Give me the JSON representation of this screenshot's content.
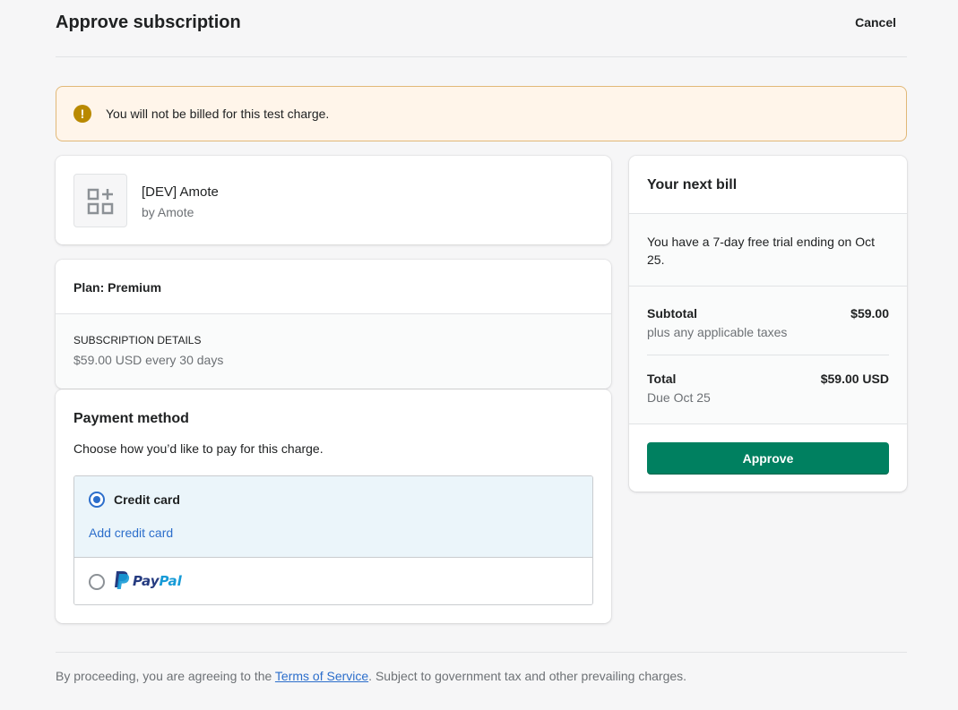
{
  "header": {
    "title": "Approve subscription",
    "cancel_label": "Cancel"
  },
  "banner": {
    "icon": "alert-circle-icon",
    "icon_glyph": "!",
    "text": "You will not be billed for this test charge."
  },
  "app": {
    "icon": "apps-icon",
    "name": "[DEV] Amote",
    "by": "by Amote"
  },
  "plan": {
    "label": "Plan: Premium",
    "details_heading": "SUBSCRIPTION DETAILS",
    "details_price": "$59.00 USD every 30 days"
  },
  "payment": {
    "title": "Payment method",
    "description": "Choose how you’d like to pay for this charge.",
    "options": [
      {
        "label": "Credit card",
        "selected": true,
        "action_label": "Add credit card"
      },
      {
        "label": "PayPal",
        "logo_text_1": "Pay",
        "logo_text_2": "Pal",
        "selected": false
      }
    ]
  },
  "bill": {
    "title": "Your next bill",
    "trial_text": "You have a 7-day free trial ending on Oct 25.",
    "subtotal_label": "Subtotal",
    "subtotal_value": "$59.00",
    "subtotal_note": "plus any applicable taxes",
    "total_label": "Total",
    "total_value": "$59.00 USD",
    "total_note": "Due Oct 25",
    "approve_label": "Approve"
  },
  "footer": {
    "text_before": "By proceeding, you are agreeing to the ",
    "terms_link": "Terms of Service",
    "text_after": ". Subject to government tax and other prevailing charges."
  },
  "colors": {
    "primary": "#008060",
    "link": "#2c6ecb",
    "banner_bg": "#fff5ea",
    "banner_border": "#e1b878",
    "warning_icon": "#b98900",
    "selected_option_bg": "#ebf5fa",
    "paypal_dark": "#253b80",
    "paypal_light": "#179bd7"
  }
}
